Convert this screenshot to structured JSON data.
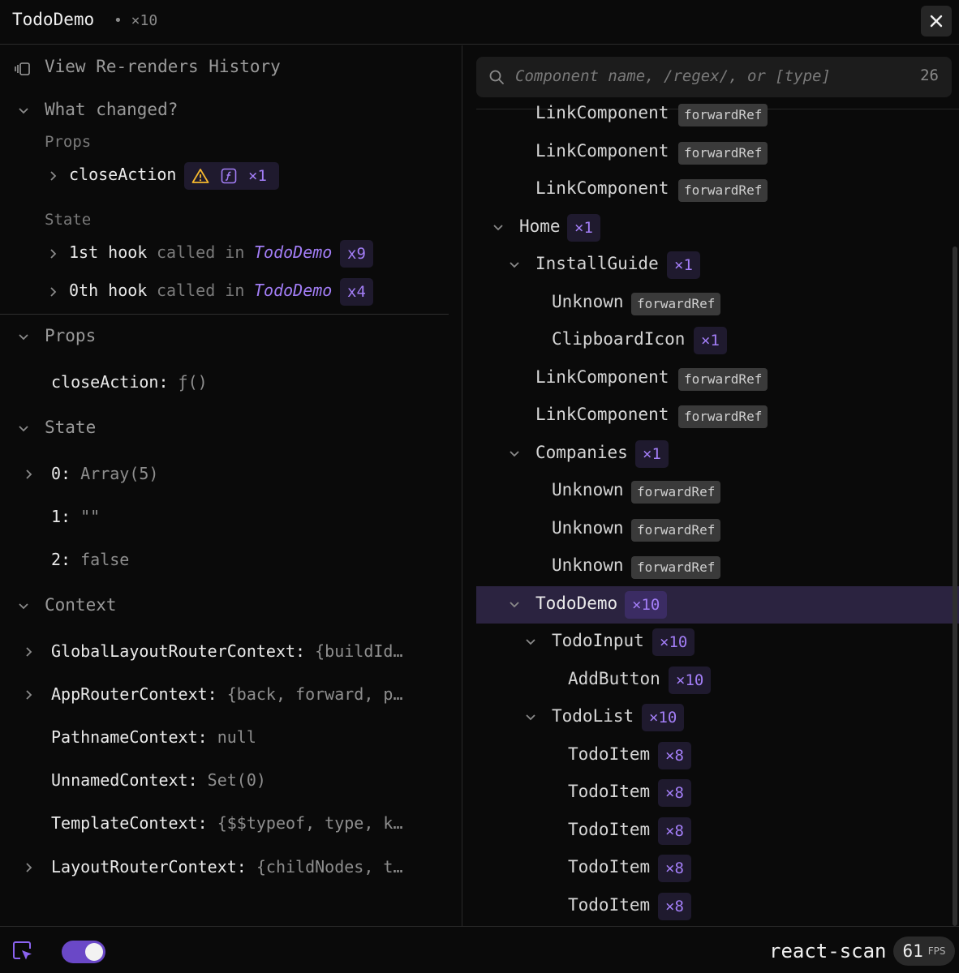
{
  "header": {
    "title": "TodoDemo",
    "meta": "• ×10"
  },
  "left": {
    "history_label": "View Re-renders History",
    "what_changed": {
      "title": "What changed?",
      "props_label": "Props",
      "prop_change": {
        "name": "closeAction",
        "count": "×1"
      },
      "state_label": "State",
      "hooks": [
        {
          "name": "1st hook",
          "called_in": "called in",
          "component": "TodoDemo",
          "count": "x9"
        },
        {
          "name": "0th hook",
          "called_in": "called in",
          "component": "TodoDemo",
          "count": "x4"
        }
      ]
    },
    "props": {
      "title": "Props",
      "items": [
        {
          "key": "closeAction:",
          "value": "ƒ()"
        }
      ]
    },
    "state": {
      "title": "State",
      "items": [
        {
          "key": "0:",
          "value": "Array(5)"
        },
        {
          "key": "1:",
          "value": "\"\""
        },
        {
          "key": "2:",
          "value": "false"
        }
      ]
    },
    "context": {
      "title": "Context",
      "items": [
        {
          "key": "GlobalLayoutRouterContext:",
          "value": "{buildId…"
        },
        {
          "key": "AppRouterContext:",
          "value": "{back, forward, p…"
        },
        {
          "key": "PathnameContext:",
          "value": "null"
        },
        {
          "key": "UnnamedContext:",
          "value": "Set(0)"
        },
        {
          "key": "TemplateContext:",
          "value": "{$$typeof, type, k…"
        },
        {
          "key": "LayoutRouterContext:",
          "value": "{childNodes, t…"
        }
      ]
    }
  },
  "search": {
    "placeholder": "Component name, /regex/, or [type]",
    "count": "26"
  },
  "tree": [
    {
      "name": "LinkComponent",
      "tag": "forwardRef"
    },
    {
      "name": "LinkComponent",
      "tag": "forwardRef"
    },
    {
      "name": "LinkComponent",
      "tag": "forwardRef"
    },
    {
      "name": "Home",
      "count": "×1"
    },
    {
      "name": "InstallGuide",
      "count": "×1"
    },
    {
      "name": "Unknown",
      "tag": "forwardRef"
    },
    {
      "name": "ClipboardIcon",
      "count": "×1"
    },
    {
      "name": "LinkComponent",
      "tag": "forwardRef"
    },
    {
      "name": "LinkComponent",
      "tag": "forwardRef"
    },
    {
      "name": "Companies",
      "count": "×1"
    },
    {
      "name": "Unknown",
      "tag": "forwardRef"
    },
    {
      "name": "Unknown",
      "tag": "forwardRef"
    },
    {
      "name": "Unknown",
      "tag": "forwardRef"
    },
    {
      "name": "TodoDemo",
      "count": "×10"
    },
    {
      "name": "TodoInput",
      "count": "×10"
    },
    {
      "name": "AddButton",
      "count": "×10"
    },
    {
      "name": "TodoList",
      "count": "×10"
    },
    {
      "name": "TodoItem",
      "count": "×8"
    },
    {
      "name": "TodoItem",
      "count": "×8"
    },
    {
      "name": "TodoItem",
      "count": "×8"
    },
    {
      "name": "TodoItem",
      "count": "×8"
    },
    {
      "name": "TodoItem",
      "count": "×8"
    }
  ],
  "footer": {
    "brand": "react-scan",
    "fps_value": "61",
    "fps_unit": "FPS",
    "toggle_on": true
  },
  "colors": {
    "accent": "#a37ef7",
    "selected_row": "#2b2340",
    "badge_bg": "#1f1a2e",
    "warning": "#f5b82e",
    "toggle": "#6a48c7"
  }
}
